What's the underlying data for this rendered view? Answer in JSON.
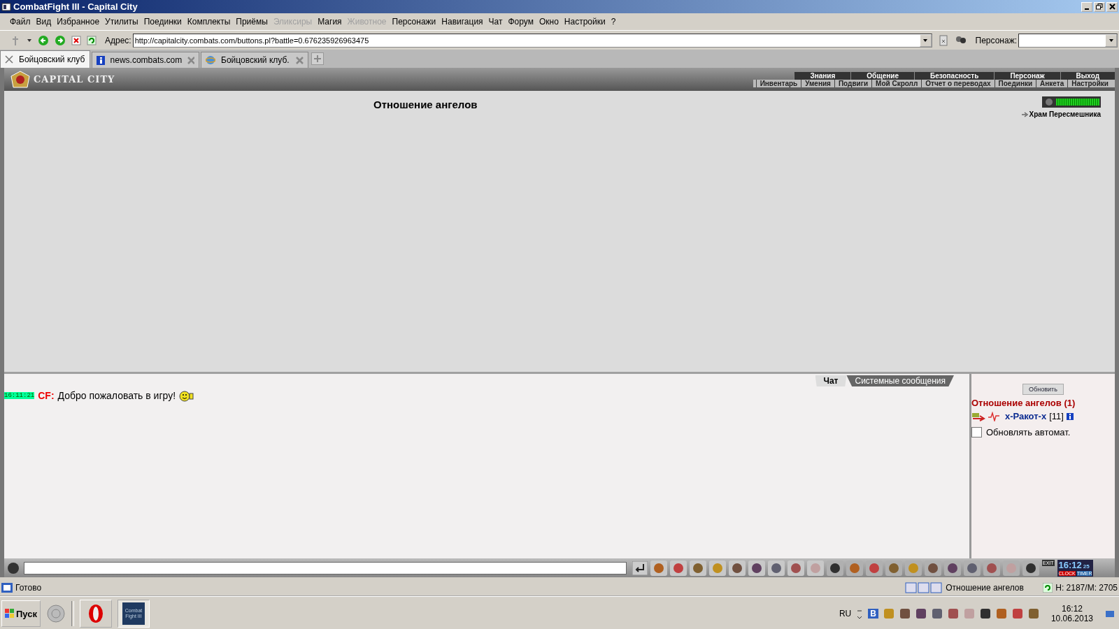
{
  "window": {
    "title": "CombatFight III - Capital City"
  },
  "menu": [
    {
      "label": "Файл",
      "disabled": false
    },
    {
      "label": "Вид",
      "disabled": false
    },
    {
      "label": "Избранное",
      "disabled": false
    },
    {
      "label": "Утилиты",
      "disabled": false
    },
    {
      "label": "Поединки",
      "disabled": false
    },
    {
      "label": "Комплекты",
      "disabled": false
    },
    {
      "label": "Приёмы",
      "disabled": false
    },
    {
      "label": "Эликсиры",
      "disabled": true
    },
    {
      "label": "Магия",
      "disabled": false
    },
    {
      "label": "Животное",
      "disabled": true
    },
    {
      "label": "Персонажи",
      "disabled": false
    },
    {
      "label": "Навигация",
      "disabled": false
    },
    {
      "label": "Чат",
      "disabled": false
    },
    {
      "label": "Форум",
      "disabled": false
    },
    {
      "label": "Окно",
      "disabled": false
    },
    {
      "label": "Настройки",
      "disabled": false
    },
    {
      "label": "?",
      "disabled": false
    }
  ],
  "address": {
    "label": "Адрес:",
    "value": "http://capitalcity.combats.com/buttons.pl?battle=0.676235926963475"
  },
  "character": {
    "label": "Персонаж:"
  },
  "browser_tabs": [
    {
      "label": "Бойцовский клуб",
      "selected": true
    },
    {
      "label": "news.combats.com",
      "selected": false
    },
    {
      "label": "Бойцовский клуб.",
      "selected": false
    }
  ],
  "game_nav": {
    "logo": "CAPITAL CITY",
    "top": [
      "Знания",
      "Общение",
      "Безопасность",
      "Персонаж",
      "Выход"
    ],
    "sub": [
      "Инвентарь",
      "Умения",
      "Подвиги",
      "Мой Скролл",
      "Отчет о переводах",
      "Поединки",
      "Анкета",
      "Настройки"
    ]
  },
  "main": {
    "title": "Отношение ангелов",
    "location_link": "Храм Пересмешника",
    "hp": {
      "level": 1
    }
  },
  "chat_tabs": [
    {
      "label": "Чат",
      "selected": true
    },
    {
      "label": "Системные сообщения",
      "selected": false
    }
  ],
  "messages": [
    {
      "time": "16:11:21",
      "author": "CF:",
      "text": "Добро пожаловать в игру!"
    }
  ],
  "side": {
    "refresh": "Обновить",
    "heading": "Отношение ангелов (1)",
    "players": [
      {
        "name": "x-Ракот-x",
        "level": "[11]"
      }
    ],
    "auto_refresh": {
      "label": "Обновлять автомат.",
      "checked": false
    }
  },
  "clock": {
    "time": "16:12",
    "seconds": "25",
    "exit": "EXIT",
    "clock_label": "CLOCK",
    "timer_label": "TIMER"
  },
  "status_bar": {
    "text": "Готово",
    "page": "Отношение ангелов",
    "stats": "H: 2187/M: 2705"
  },
  "taskbar": {
    "start": "Пуск",
    "app": "Combat Fight III",
    "lang": "RU",
    "tray_letter": "B",
    "time": "16:12",
    "date": "10.06.2013"
  }
}
